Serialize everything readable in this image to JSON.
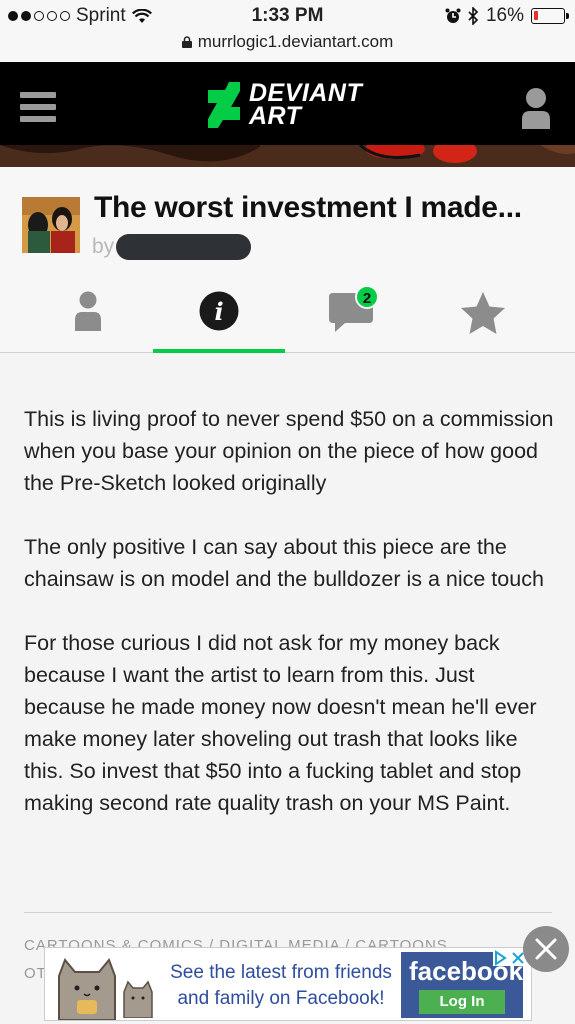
{
  "status_bar": {
    "carrier": "Sprint",
    "time": "1:33 PM",
    "battery_percent": "16%",
    "battery_level": 0.16,
    "url": "murrlogic1.deviantart.com"
  },
  "header": {
    "logo_line1": "DEVIANT",
    "logo_line2": "ART"
  },
  "deviation": {
    "title": "The worst investment I made...",
    "by_label": "by",
    "tabs": [
      {
        "name": "artist"
      },
      {
        "name": "info",
        "glyph": "i"
      },
      {
        "name": "comments",
        "count": "2"
      },
      {
        "name": "favourite"
      }
    ],
    "description": [
      "This is living proof to never spend $50 on a commission when you base your opinion on the piece of how good the Pre-Sketch looked originally",
      "The only positive I can say about this piece are the chainsaw is on model and the bulldozer is a nice touch",
      "For those curious I did not ask for my money back because I want the artist to learn from this. Just because he made money now doesn't mean he'll ever make money later shoveling out trash that looks like this. So invest that $50 into a fucking tablet and stop making second rate quality trash on your MS Paint."
    ],
    "categories": "CARTOONS & COMICS / DIGITAL MEDIA / CARTOONS",
    "categories_cont": "OT"
  },
  "ad": {
    "text_line1": "See the latest from friends",
    "text_line2": "and family on Facebook!",
    "brand": "facebook",
    "login_label": "Log In"
  },
  "colors": {
    "accent_green": "#05cc47",
    "header_bg": "#000000",
    "facebook_blue": "#3b5998"
  }
}
